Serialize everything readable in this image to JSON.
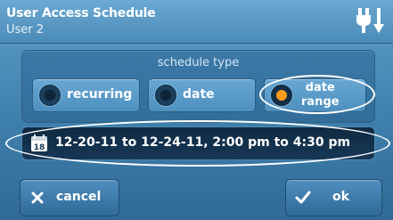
{
  "header": {
    "title": "User Access Schedule",
    "subtitle": "User 2",
    "icon": "power-plug-icon"
  },
  "schedule": {
    "title": "schedule type",
    "options": [
      {
        "label": "recurring",
        "selected": false
      },
      {
        "label": "date",
        "selected": false
      },
      {
        "label_line1": "date",
        "label_line2": "range",
        "selected": true
      }
    ]
  },
  "date_range": {
    "icon_day": "18",
    "text": "12-20-11 to 12-24-11, 2:00 pm to 4:30 pm"
  },
  "footer": {
    "cancel_label": "cancel",
    "ok_label": "ok"
  },
  "colors": {
    "selected_radio": "#ff9b1a",
    "highlight_ellipse": "#ffffff"
  }
}
